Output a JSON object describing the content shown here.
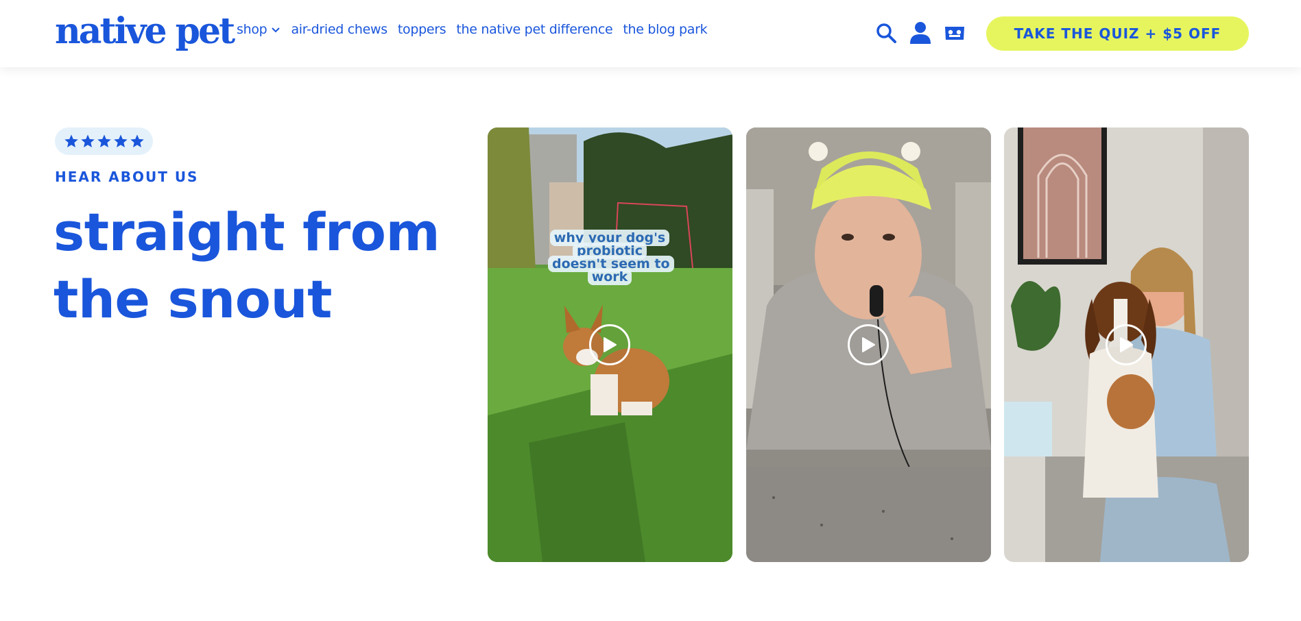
{
  "header": {
    "logo": "native pet",
    "nav": [
      {
        "label": "shop"
      },
      {
        "label": "air-dried chews"
      },
      {
        "label": "toppers"
      },
      {
        "label": "the native pet difference"
      },
      {
        "label": "the blog park"
      }
    ],
    "icons": [
      "search-icon",
      "account-icon",
      "cart-icon"
    ],
    "cta_label": "TAKE THE QUIZ + $5 OFF"
  },
  "hero": {
    "rating": 5,
    "eyebrow": "HEAR ABOUT US",
    "headline_line1": "straight from",
    "headline_line2": "the snout"
  },
  "videos": [
    {
      "caption": "why your dog's probiotic doesn't seem to work",
      "icon": "play-icon"
    },
    {
      "caption": "",
      "icon": "play-icon"
    },
    {
      "caption": "",
      "icon": "play-icon"
    }
  ],
  "colors": {
    "brand_blue": "#1a56db",
    "cta_yellow": "#e6f55e",
    "rating_bg": "#e4f1fb"
  }
}
